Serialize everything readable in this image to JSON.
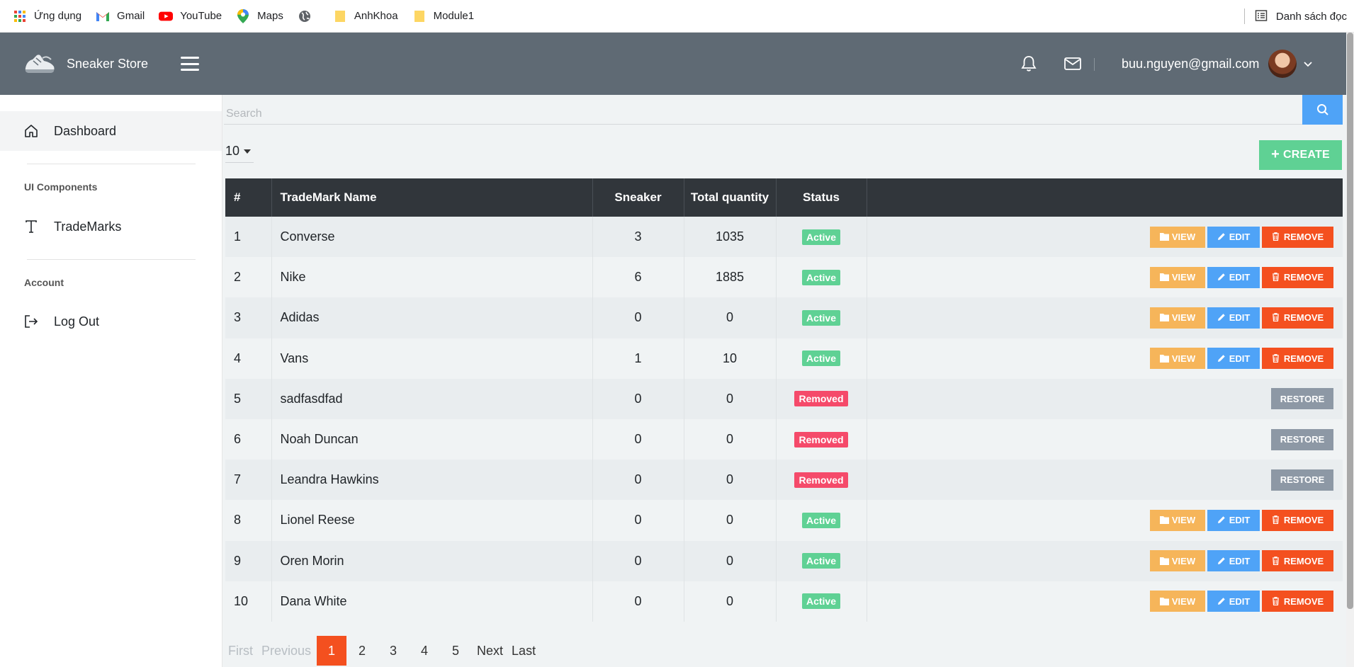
{
  "bookmarks": {
    "items": [
      {
        "label": "Ứng dụng",
        "icon": "apps-grid-icon"
      },
      {
        "label": "Gmail",
        "icon": "gmail-icon"
      },
      {
        "label": "YouTube",
        "icon": "youtube-icon"
      },
      {
        "label": "Maps",
        "icon": "maps-pin-icon"
      },
      {
        "label": "",
        "icon": "globe-icon"
      },
      {
        "label": "AnhKhoa",
        "icon": "folder-icon"
      },
      {
        "label": "Module1",
        "icon": "folder-icon"
      }
    ],
    "reading_list": "Danh sách đọc"
  },
  "brand": {
    "name": "Sneaker Store"
  },
  "header": {
    "user_email": "buu.nguyen@gmail.com"
  },
  "sidebar": {
    "dashboard": "Dashboard",
    "section_ui": "UI Components",
    "trademarks": "TradeMarks",
    "section_account": "Account",
    "logout": "Log Out"
  },
  "search": {
    "placeholder": "Search"
  },
  "toolbar": {
    "page_size": "10",
    "create_label": "CREATE"
  },
  "table": {
    "headers": [
      "#",
      "TradeMark Name",
      "Sneaker",
      "Total quantity",
      "Status",
      ""
    ],
    "rows": [
      {
        "id": "1",
        "name": "Converse",
        "sneaker": "3",
        "total": "1035",
        "status": "Active"
      },
      {
        "id": "2",
        "name": "Nike",
        "sneaker": "6",
        "total": "1885",
        "status": "Active"
      },
      {
        "id": "3",
        "name": "Adidas",
        "sneaker": "0",
        "total": "0",
        "status": "Active"
      },
      {
        "id": "4",
        "name": "Vans",
        "sneaker": "1",
        "total": "10",
        "status": "Active"
      },
      {
        "id": "5",
        "name": "sadfasdfad",
        "sneaker": "0",
        "total": "0",
        "status": "Removed"
      },
      {
        "id": "6",
        "name": "Noah Duncan",
        "sneaker": "0",
        "total": "0",
        "status": "Removed"
      },
      {
        "id": "7",
        "name": "Leandra Hawkins",
        "sneaker": "0",
        "total": "0",
        "status": "Removed"
      },
      {
        "id": "8",
        "name": "Lionel Reese",
        "sneaker": "0",
        "total": "0",
        "status": "Active"
      },
      {
        "id": "9",
        "name": "Oren Morin",
        "sneaker": "0",
        "total": "0",
        "status": "Active"
      },
      {
        "id": "10",
        "name": "Dana White",
        "sneaker": "0",
        "total": "0",
        "status": "Active"
      }
    ]
  },
  "actions": {
    "view": "VIEW",
    "edit": "EDIT",
    "remove": "REMOVE",
    "restore": "RESTORE"
  },
  "pagination": {
    "first": "First",
    "previous": "Previous",
    "pages": [
      "1",
      "2",
      "3",
      "4",
      "5"
    ],
    "current": "1",
    "next": "Next",
    "last": "Last"
  },
  "colors": {
    "topbar": "#5f6a74",
    "table_header": "#31363b",
    "active_badge": "#5fd194",
    "removed_badge": "#f54a6a",
    "view_button": "#f6b55a",
    "edit_button": "#4fa3f7",
    "remove_button": "#f4501f",
    "restore_button": "#8d98a5",
    "create_button": "#5fd194"
  }
}
